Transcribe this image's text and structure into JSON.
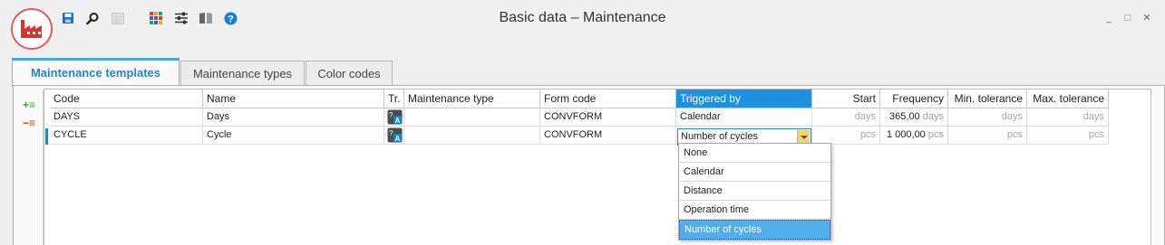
{
  "window": {
    "title": "Basic data – Maintenance",
    "minimize": "_",
    "maximize": "□",
    "close": "✕"
  },
  "toolbar": {
    "icons": [
      "save-icon",
      "search-icon",
      "report-icon",
      "color-grid-icon",
      "settings-sliders-icon",
      "book-icon",
      "help-icon"
    ],
    "help_label": "?"
  },
  "tabs": [
    {
      "label": "Maintenance templates",
      "active": true
    },
    {
      "label": "Maintenance types",
      "active": false
    },
    {
      "label": "Color codes",
      "active": false
    }
  ],
  "row_tools": {
    "add": "+≡",
    "remove": "−≡"
  },
  "grid": {
    "headers": [
      "Code",
      "Name",
      "Tr.",
      "Maintenance type",
      "Form code",
      "Triggered by",
      "Start",
      "Frequency",
      "Min. tolerance",
      "Max. tolerance"
    ],
    "rows": [
      {
        "code": "DAYS",
        "name": "Days",
        "maintenance_type": "",
        "form_code": "CONVFORM",
        "triggered_by": "Calendar",
        "start_unit": "days",
        "frequency_value": "365,00",
        "frequency_unit": "days",
        "min_unit": "days",
        "max_unit": "days"
      },
      {
        "code": "CYCLE",
        "name": "Cycle",
        "maintenance_type": "",
        "form_code": "CONVFORM",
        "triggered_by": "Number of cycles",
        "start_unit": "pcs",
        "frequency_value": "1 000,00",
        "frequency_unit": "pcs",
        "min_unit": "pcs",
        "max_unit": "pcs"
      }
    ]
  },
  "dropdown": {
    "options": [
      "None",
      "Calendar",
      "Distance",
      "Operation time",
      "Number of cycles"
    ],
    "selected": "Number of cycles"
  },
  "colors": {
    "accent": "#2684c8",
    "header_selected": "#1e90e0",
    "dropdown_selected": "#51aeea",
    "logo_red": "#d9342b"
  }
}
